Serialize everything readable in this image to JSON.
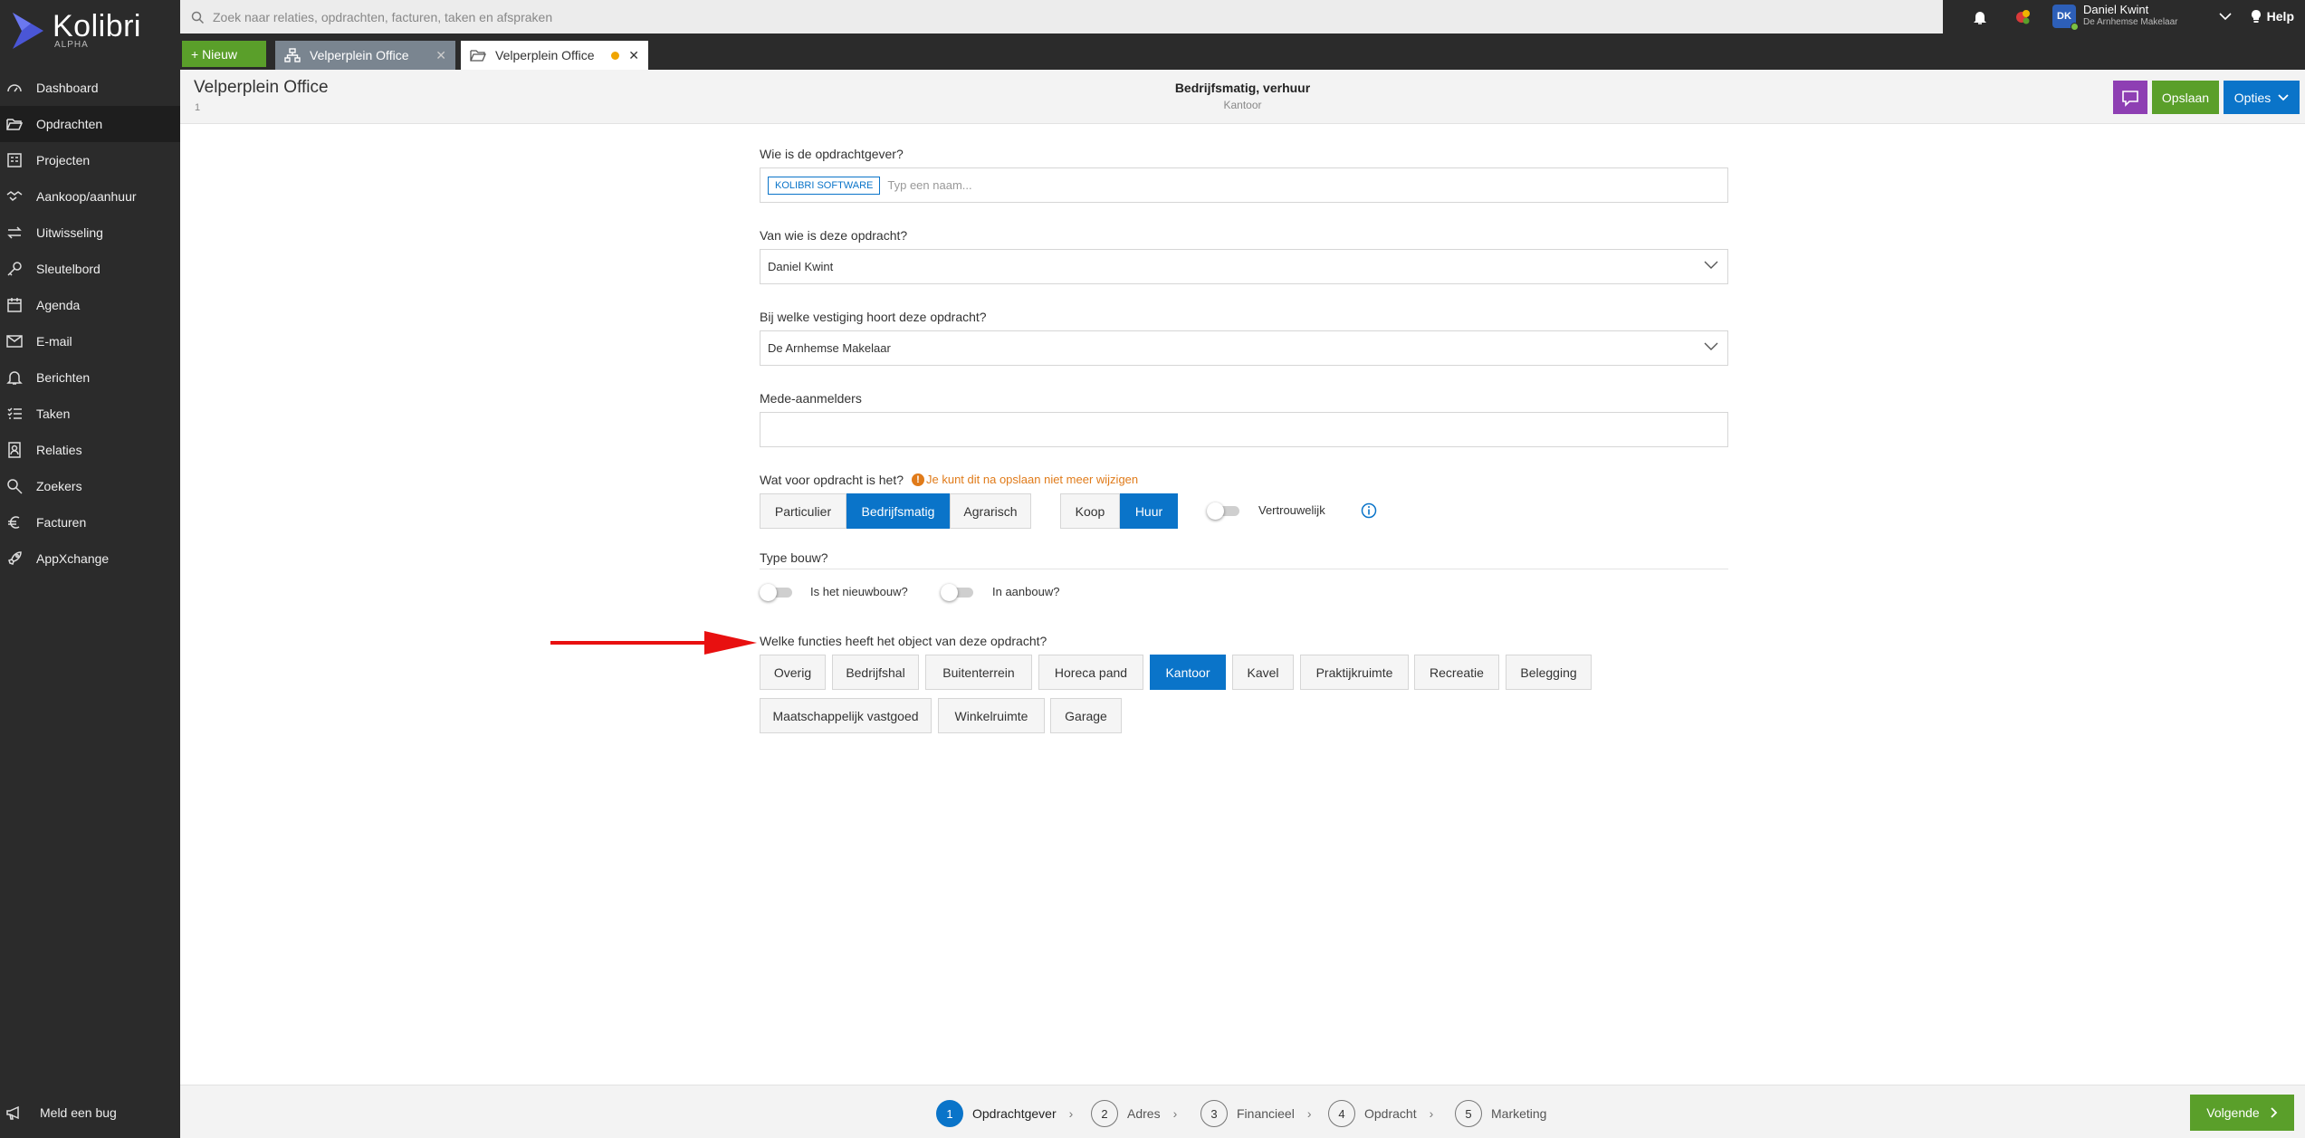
{
  "app": {
    "name": "Kolibri",
    "edition": "ALPHA"
  },
  "sidebar": {
    "items": [
      {
        "label": "Dashboard"
      },
      {
        "label": "Opdrachten"
      },
      {
        "label": "Projecten"
      },
      {
        "label": "Aankoop/aanhuur"
      },
      {
        "label": "Uitwisseling"
      },
      {
        "label": "Sleutelbord"
      },
      {
        "label": "Agenda"
      },
      {
        "label": "E-mail"
      },
      {
        "label": "Berichten"
      },
      {
        "label": "Taken"
      },
      {
        "label": "Relaties"
      },
      {
        "label": "Zoekers"
      },
      {
        "label": "Facturen"
      },
      {
        "label": "AppXchange"
      }
    ],
    "active_item": "Opdrachten",
    "bug_label": "Meld een bug"
  },
  "topbar": {
    "search_placeholder": "Zoek naar relaties, opdrachten, facturen, taken en afspraken",
    "user": {
      "initials": "DK",
      "name": "Daniel Kwint",
      "org": "De Arnhemse Makelaar"
    },
    "help_label": "Help"
  },
  "tabs": {
    "new_label": "+ Nieuw",
    "items": [
      {
        "label": "Velperplein Office",
        "icon": "sitemap-icon"
      },
      {
        "label": "Velperplein Office",
        "icon": "folder-open-icon",
        "unsaved": true
      }
    ]
  },
  "header": {
    "title": "Velperplein Office",
    "subtitle": "1",
    "center_title": "Bedrijfsmatig, verhuur",
    "center_subtitle": "Kantoor",
    "save_label": "Opslaan",
    "options_label": "Opties"
  },
  "form": {
    "client": {
      "label": "Wie is de opdrachtgever?",
      "tag": "KOLIBRI SOFTWARE",
      "placeholder": "Typ een naam..."
    },
    "owner": {
      "label": "Van wie is deze opdracht?",
      "value": "Daniel Kwint"
    },
    "branch": {
      "label": "Bij welke vestiging hoort deze opdracht?",
      "value": "De Arnhemse Makelaar"
    },
    "co_registrants": {
      "label": "Mede-aanmelders",
      "value": ""
    },
    "assignment_type": {
      "label": "Wat voor opdracht is het?",
      "warning": "Je kunt dit na opslaan niet meer wijzigen",
      "categories": [
        "Particulier",
        "Bedrijfsmatig",
        "Agrarisch"
      ],
      "selected_category": "Bedrijfsmatig",
      "transaction": [
        "Koop",
        "Huur"
      ],
      "selected_transaction": "Huur",
      "confidential_label": "Vertrouwelijk",
      "confidential": false
    },
    "build_type": {
      "label": "Type bouw?",
      "new_build_label": "Is het nieuwbouw?",
      "new_build": false,
      "under_construction_label": "In aanbouw?",
      "under_construction": false
    },
    "functions": {
      "label": "Welke functies heeft het object van deze opdracht?",
      "row1": [
        "Overig",
        "Bedrijfshal",
        "Buitenterrein",
        "Horeca pand",
        "Kantoor",
        "Kavel",
        "Praktijkruimte",
        "Recreatie",
        "Belegging"
      ],
      "row2": [
        "Maatschappelijk vastgoed",
        "Winkelruimte",
        "Garage"
      ],
      "selected": "Kantoor"
    }
  },
  "footer": {
    "steps": [
      {
        "num": "1",
        "label": "Opdrachtgever",
        "active": true
      },
      {
        "num": "2",
        "label": "Adres",
        "active": false
      },
      {
        "num": "3",
        "label": "Financieel",
        "active": false
      },
      {
        "num": "4",
        "label": "Opdracht",
        "active": false
      },
      {
        "num": "5",
        "label": "Marketing",
        "active": false
      }
    ],
    "next_label": "Volgende"
  },
  "colors": {
    "sidebar_bg": "#2b2b2b",
    "primary_blue": "#0a74c9",
    "green": "#5a9f2a",
    "purple": "#8e3fb3",
    "warning_orange": "#e07b1a",
    "arrow_red": "#e81010"
  }
}
